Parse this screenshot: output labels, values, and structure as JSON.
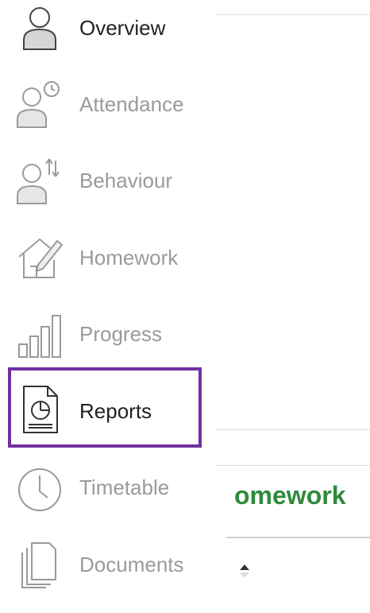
{
  "sidebar": {
    "items": [
      {
        "label": "Overview",
        "icon": "user-icon",
        "state": "current"
      },
      {
        "label": "Attendance",
        "icon": "user-clock-icon",
        "state": "default"
      },
      {
        "label": "Behaviour",
        "icon": "user-arrows-icon",
        "state": "default"
      },
      {
        "label": "Homework",
        "icon": "house-pencil-icon",
        "state": "default"
      },
      {
        "label": "Progress",
        "icon": "bar-chart-icon",
        "state": "default"
      },
      {
        "label": "Reports",
        "icon": "report-pie-icon",
        "state": "highlighted"
      },
      {
        "label": "Timetable",
        "icon": "clock-icon",
        "state": "default"
      },
      {
        "label": "Documents",
        "icon": "documents-icon",
        "state": "default"
      }
    ]
  },
  "main": {
    "heading_partial": "omework"
  },
  "colors": {
    "highlight": "#7030a0",
    "heading": "#2e8b3a",
    "label_active": "#222222",
    "label_inactive": "#9a9a9a"
  }
}
